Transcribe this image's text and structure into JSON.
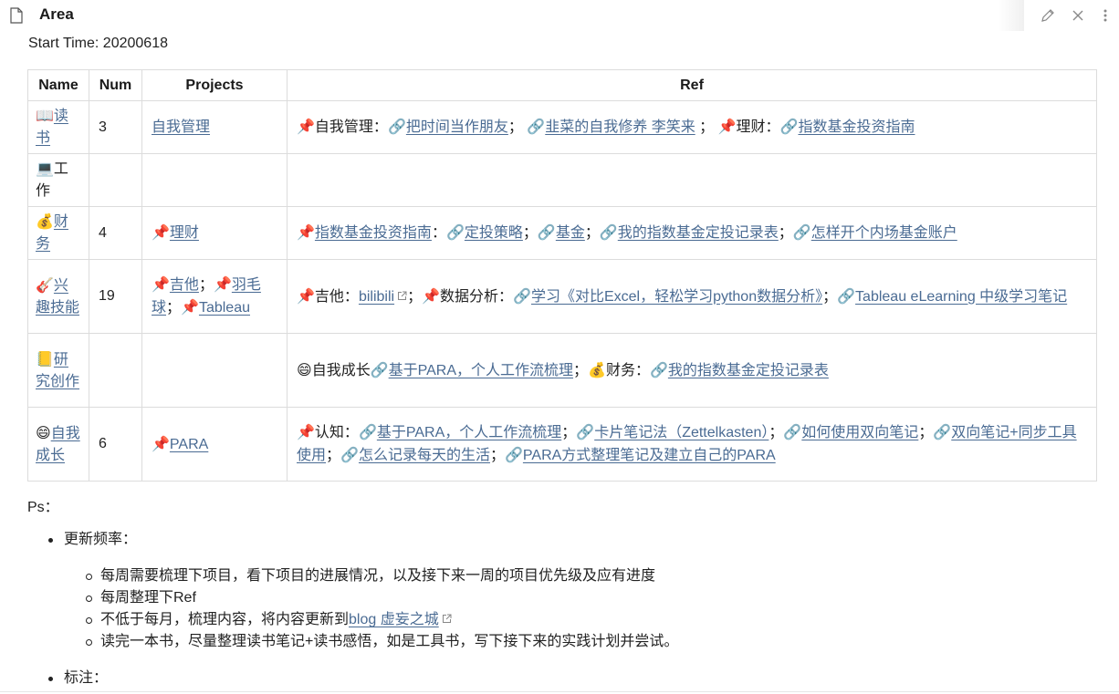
{
  "header": {
    "title": "Area",
    "doc_icon": "document-icon",
    "edit_icon": "pencil-icon",
    "close_icon": "close-icon",
    "more_icon": "more-vertical-icon"
  },
  "start_time": "Start Time: 20200618",
  "table": {
    "headers": [
      "Name",
      "Num",
      "Projects",
      "Ref"
    ],
    "rows": [
      {
        "emoji": "📖",
        "name": "读书",
        "name_link": true,
        "num": "3",
        "projects": [
          {
            "pin": "",
            "text": "自我管理",
            "link": true,
            "sep": ""
          }
        ],
        "ref": [
          {
            "t": "pin",
            "v": "📌"
          },
          {
            "t": "text",
            "v": "自我管理："
          },
          {
            "t": "chain",
            "v": "🔗"
          },
          {
            "t": "link",
            "v": "把时间当作朋友"
          },
          {
            "t": "text",
            "v": "； "
          },
          {
            "t": "chain",
            "v": "🔗"
          },
          {
            "t": "link",
            "v": "韭菜的自我修养 李笑来"
          },
          {
            "t": "text",
            "v": " ； "
          },
          {
            "t": "pin",
            "v": "📌"
          },
          {
            "t": "text",
            "v": "理财："
          },
          {
            "t": "chain",
            "v": "🔗"
          },
          {
            "t": "link",
            "v": "指数基金投资指南"
          }
        ]
      },
      {
        "emoji": "💻",
        "name": "工作",
        "name_link": false,
        "num": "",
        "projects": [],
        "ref": []
      },
      {
        "emoji": "💰",
        "name": "财务",
        "name_link": true,
        "num": "4",
        "projects": [
          {
            "pin": "📌",
            "text": "理财",
            "link": true,
            "sep": ""
          }
        ],
        "ref": [
          {
            "t": "pin",
            "v": "📌"
          },
          {
            "t": "link",
            "v": "指数基金投资指南"
          },
          {
            "t": "text",
            "v": "："
          },
          {
            "t": "chain",
            "v": "🔗"
          },
          {
            "t": "link",
            "v": "定投策略"
          },
          {
            "t": "text",
            "v": "；"
          },
          {
            "t": "chain",
            "v": "🔗"
          },
          {
            "t": "link",
            "v": "基金"
          },
          {
            "t": "text",
            "v": "；"
          },
          {
            "t": "chain",
            "v": "🔗"
          },
          {
            "t": "link",
            "v": "我的指数基金定投记录表"
          },
          {
            "t": "text",
            "v": "；"
          },
          {
            "t": "chain",
            "v": "🔗"
          },
          {
            "t": "link",
            "v": "怎样开个内场基金账户"
          }
        ]
      },
      {
        "emoji": "🎸",
        "name": "兴趣技能",
        "name_link": true,
        "num": "19",
        "projects": [
          {
            "pin": "📌",
            "text": "吉他",
            "link": true,
            "sep": "；"
          },
          {
            "pin": "📌",
            "text": "羽毛球",
            "link": true,
            "sep": "；"
          },
          {
            "pin": "📌",
            "text": "Tableau",
            "link": true,
            "sep": ""
          }
        ],
        "ref": [
          {
            "t": "pin",
            "v": "📌"
          },
          {
            "t": "text",
            "v": "吉他："
          },
          {
            "t": "link",
            "v": "bilibili"
          },
          {
            "t": "ext",
            "v": "external-link-icon"
          },
          {
            "t": "text",
            "v": "；"
          },
          {
            "t": "pin",
            "v": "📌"
          },
          {
            "t": "text",
            "v": "数据分析："
          },
          {
            "t": "chain",
            "v": "🔗"
          },
          {
            "t": "link",
            "v": "学习《对比Excel，轻松学习python数据分析》"
          },
          {
            "t": "text",
            "v": "；"
          },
          {
            "t": "chain",
            "v": "🔗"
          },
          {
            "t": "link",
            "v": "Tableau eLearning 中级学习笔记"
          }
        ]
      },
      {
        "emoji": "📒",
        "name": "研究创作",
        "name_link": true,
        "num": "",
        "projects": [],
        "ref": [
          {
            "t": "pin",
            "v": "😄"
          },
          {
            "t": "text",
            "v": "自我成长"
          },
          {
            "t": "chain",
            "v": "🔗"
          },
          {
            "t": "link",
            "v": "基于PARA，个人工作流梳理"
          },
          {
            "t": "text",
            "v": "；"
          },
          {
            "t": "pin",
            "v": "💰"
          },
          {
            "t": "text",
            "v": "财务："
          },
          {
            "t": "chain",
            "v": "🔗"
          },
          {
            "t": "link",
            "v": "我的指数基金定投记录表"
          }
        ]
      },
      {
        "emoji": "😄",
        "name": "自我成长",
        "name_link": true,
        "num": "6",
        "projects": [
          {
            "pin": "📌",
            "text": "PARA",
            "link": true,
            "sep": ""
          }
        ],
        "ref": [
          {
            "t": "pin",
            "v": "📌"
          },
          {
            "t": "text",
            "v": "认知："
          },
          {
            "t": "chain",
            "v": "🔗"
          },
          {
            "t": "link",
            "v": "基于PARA，个人工作流梳理"
          },
          {
            "t": "text",
            "v": "；"
          },
          {
            "t": "chain",
            "v": "🔗"
          },
          {
            "t": "link",
            "v": "卡片笔记法（Zettelkasten）"
          },
          {
            "t": "text",
            "v": "；"
          },
          {
            "t": "chain",
            "v": "🔗"
          },
          {
            "t": "link",
            "v": "如何使用双向笔记"
          },
          {
            "t": "text",
            "v": "；"
          },
          {
            "t": "chain",
            "v": "🔗"
          },
          {
            "t": "link",
            "v": "双向笔记+同步工具使用"
          },
          {
            "t": "text",
            "v": "；"
          },
          {
            "t": "chain",
            "v": "🔗"
          },
          {
            "t": "link",
            "v": "怎么记录每天的生活"
          },
          {
            "t": "text",
            "v": "；"
          },
          {
            "t": "chain",
            "v": "🔗"
          },
          {
            "t": "link",
            "v": "PARA方式整理笔记及建立自己的PARA"
          }
        ]
      }
    ]
  },
  "ps": {
    "label": "Ps：",
    "update_freq": "更新频率：",
    "items": [
      "每周需要梳理下项目，看下项目的进展情况，以及接下来一周的项目优先级及应有进度",
      "每周整理下Ref",
      "不低于每月，梳理内容，将内容更新到",
      "读完一本书，尽量整理读书笔记+读书感悟，如是工具书，写下接下来的实践计划并尝试。"
    ],
    "blog_link": "blog 虚妄之城",
    "note_label": "标注："
  },
  "colors": {
    "link": "#4a6b93",
    "border": "#dcdcdc",
    "text": "#222222"
  }
}
